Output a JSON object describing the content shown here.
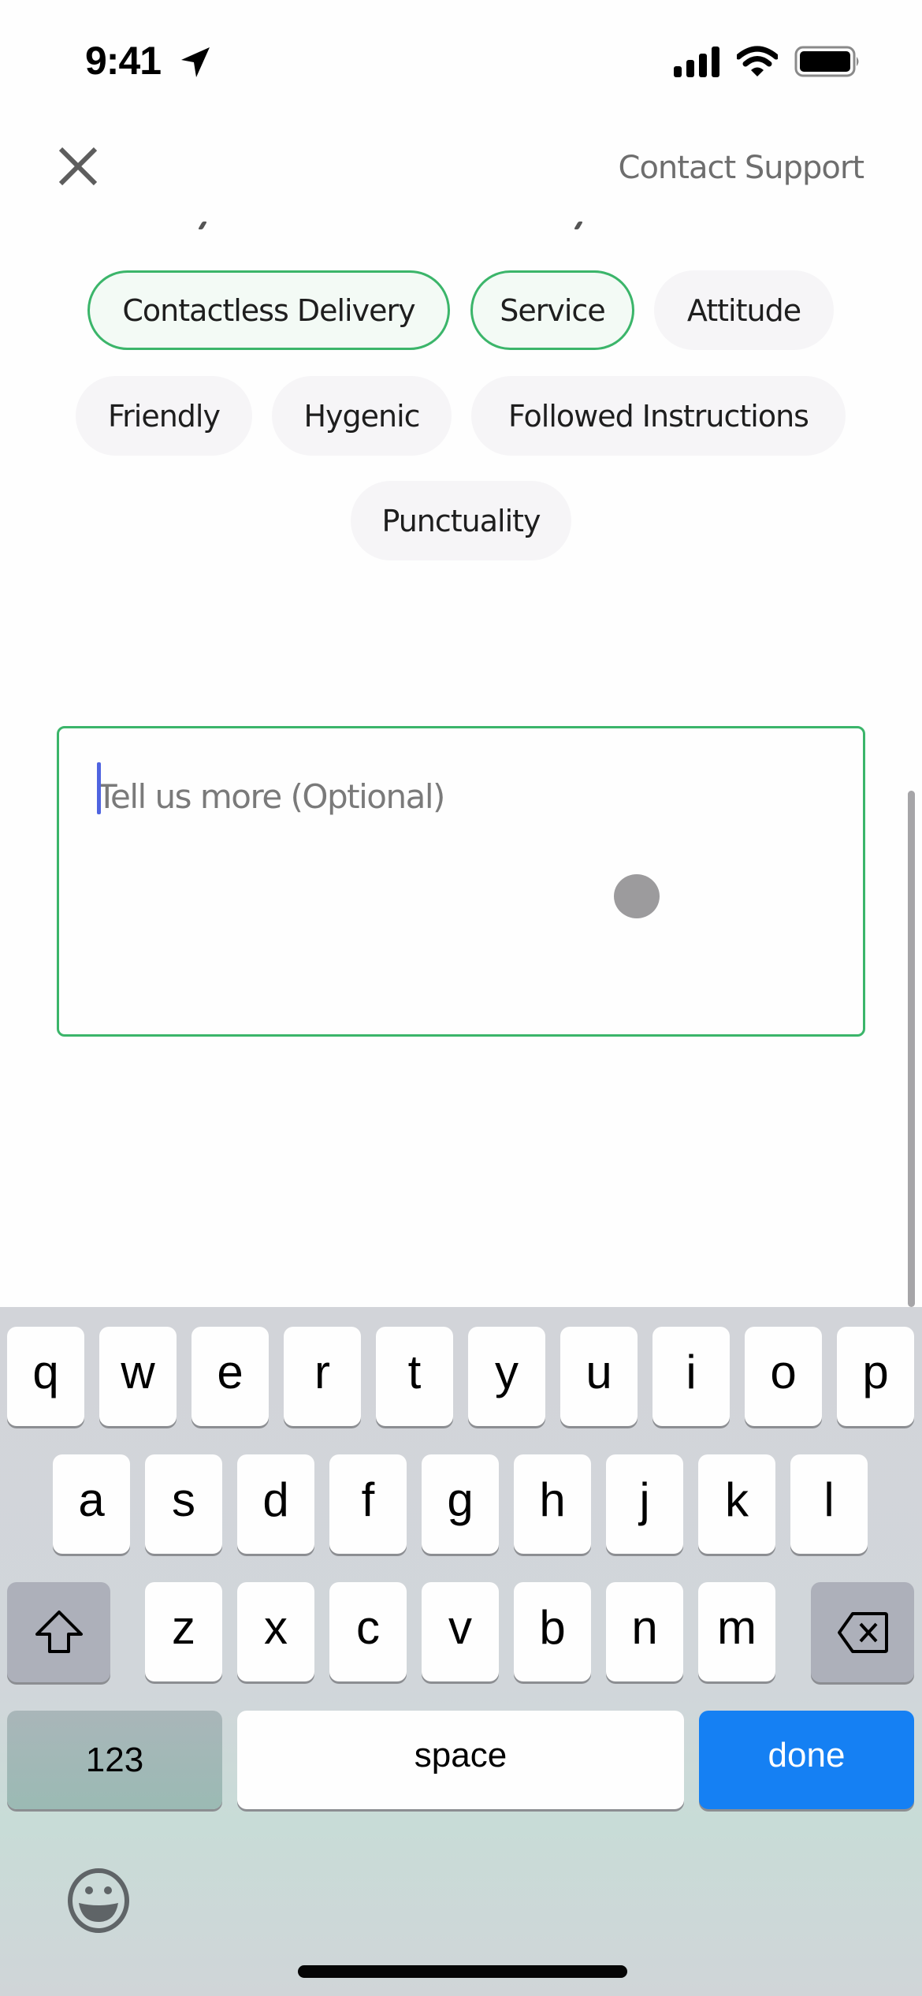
{
  "status_bar": {
    "time": "9:41",
    "icons": [
      "location-arrow-icon",
      "cellular-signal-icon",
      "wifi-icon",
      "battery-icon"
    ]
  },
  "nav": {
    "close_icon": "close-icon",
    "contact_support_label": "Contact Support"
  },
  "tags": {
    "items": [
      {
        "label": "Contactless Delivery",
        "selected": true
      },
      {
        "label": "Service",
        "selected": true
      },
      {
        "label": "Attitude",
        "selected": false
      },
      {
        "label": "Friendly",
        "selected": false
      },
      {
        "label": "Hygenic",
        "selected": false
      },
      {
        "label": "Followed Instructions",
        "selected": false
      },
      {
        "label": "Punctuality",
        "selected": false
      }
    ]
  },
  "feedback": {
    "placeholder": "Tell us more (Optional)",
    "value": ""
  },
  "colors": {
    "accent_green": "#3bb56a",
    "selected_chip_bg": "#f3faf5",
    "chip_bg": "#f6f5f7",
    "caret": "#4f64e0",
    "done_key": "#1580f3"
  },
  "keyboard": {
    "row1": [
      "q",
      "w",
      "e",
      "r",
      "t",
      "y",
      "u",
      "i",
      "o",
      "p"
    ],
    "row2": [
      "a",
      "s",
      "d",
      "f",
      "g",
      "h",
      "j",
      "k",
      "l"
    ],
    "row3": [
      "z",
      "x",
      "c",
      "v",
      "b",
      "n",
      "m"
    ],
    "shift_icon": "shift-icon",
    "delete_icon": "backspace-icon",
    "numbers_label": "123",
    "space_label": "space",
    "done_label": "done",
    "emoji_icon": "emoji-icon"
  }
}
